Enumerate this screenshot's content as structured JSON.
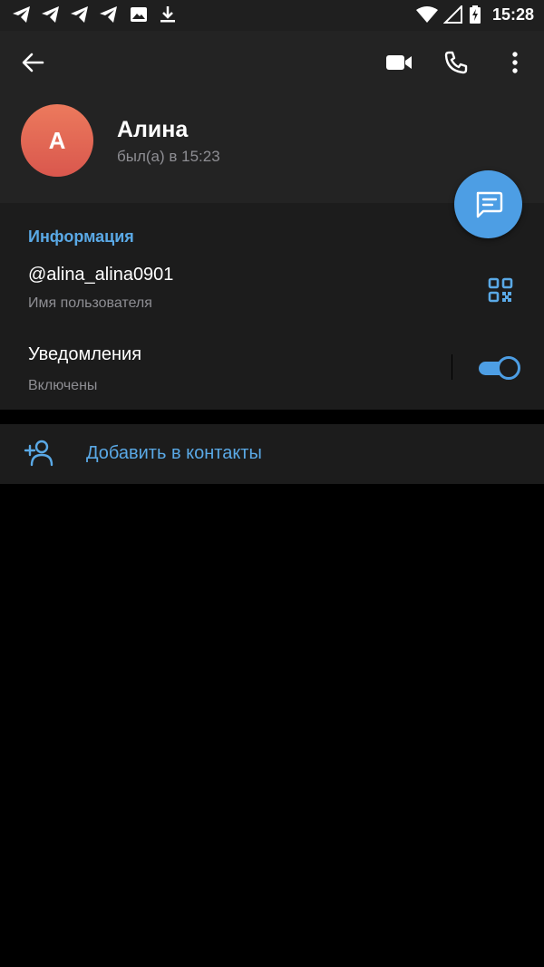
{
  "status_bar": {
    "time": "15:28",
    "notification_icons": [
      "telegram-icon",
      "telegram-icon",
      "telegram-icon",
      "telegram-icon",
      "image-icon",
      "download-icon"
    ],
    "system_icons": [
      "wifi-icon",
      "signal-icon",
      "battery-charging-icon"
    ]
  },
  "header": {
    "actions": [
      "back-arrow-icon",
      "video-call-icon",
      "phone-icon",
      "more-vert-icon"
    ],
    "avatar_letter": "А",
    "avatar_color_top": "#ec7a5d",
    "avatar_color_bottom": "#d9574d",
    "name": "Алина",
    "last_seen": "был(а) в 15:23",
    "fab_icon": "message-icon"
  },
  "info": {
    "title": "Информация",
    "username": "@alina_alina0901",
    "username_caption": "Имя пользователя",
    "qr_icon": "qr-code-icon",
    "notifications_label": "Уведомления",
    "notifications_state": "Включены",
    "notifications_enabled": true
  },
  "add_contact": {
    "label": "Добавить в контакты",
    "icon": "add-person-icon"
  },
  "colors": {
    "accent": "#4d9ee4",
    "link": "#5aa9e6",
    "header_bg": "#232323",
    "section_bg": "#1c1c1c",
    "background": "#000000",
    "secondary_text": "#8e8e93"
  }
}
